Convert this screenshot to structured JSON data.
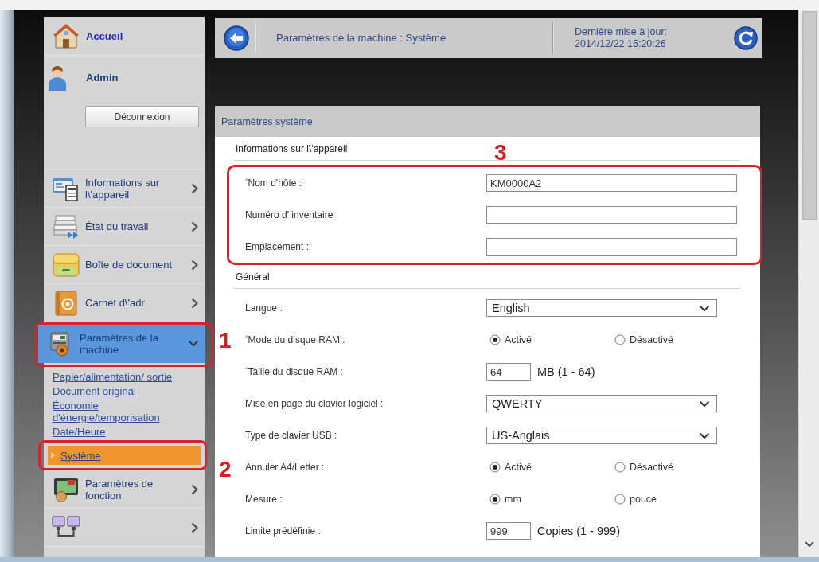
{
  "sidebar": {
    "home_link": "Accueil",
    "user": "Admin",
    "logout_button": "Déconnexion",
    "items": [
      {
        "kind": "info",
        "label": "Informations sur l\\'appareil",
        "selected": false,
        "expanded": false
      },
      {
        "kind": "job",
        "label": "État du travail",
        "selected": false,
        "expanded": false
      },
      {
        "kind": "box",
        "label": "Boîte de document",
        "selected": false,
        "expanded": false
      },
      {
        "kind": "addressbook",
        "label": "Carnet d\\'adr",
        "selected": false,
        "expanded": false
      },
      {
        "kind": "machine",
        "label": "Paramètres de la machine",
        "selected": true,
        "expanded": true,
        "callout": "1",
        "children": [
          {
            "label": "Papier/alimentation/ sortie",
            "selected": false
          },
          {
            "label": "Document original",
            "selected": false
          },
          {
            "label": "Économie d'énergie/temporisation",
            "selected": false
          },
          {
            "label": "Date/Heure",
            "selected": false
          },
          {
            "label": "Système",
            "selected": true,
            "callout": "2"
          }
        ]
      },
      {
        "kind": "function",
        "label": "Paramètres de fonction",
        "selected": false,
        "expanded": false
      },
      {
        "kind": "network",
        "selected": false,
        "expanded": false
      }
    ]
  },
  "header": {
    "title": "Paramètres de la machine : Système",
    "update_label": "Dernière mise à jour:",
    "update_time": "2014/12/22 15:20:26"
  },
  "panel": {
    "title": "Paramètres système",
    "sections": [
      {
        "heading": "Informations sur l\\'appareil",
        "callout": "3",
        "rows": [
          {
            "kind": "text",
            "label": "$^{*}$Nom d'hôte :",
            "value": "KM0000A2"
          },
          {
            "kind": "text",
            "label": "Numéro d' inventaire :"
          },
          {
            "kind": "text",
            "label": "Emplacement :"
          }
        ]
      },
      {
        "heading": "Général",
        "rows": [
          {
            "kind": "select",
            "label": "Langue :",
            "value": "English"
          },
          {
            "kind": "radio",
            "label": "$^{*}$Mode du disque RAM :",
            "options": [
              {
                "label": "Activé",
                "selected": true
              },
              {
                "label": "Désactivé",
                "selected": false
              }
            ]
          },
          {
            "kind": "number",
            "label": "$^{*}$Taille du disque RAM :",
            "value": "64",
            "unit": "MB (1 - 64)"
          },
          {
            "kind": "select",
            "label": "Mise en page du clavier logiciel :",
            "value": "QWERTY"
          },
          {
            "kind": "select",
            "label": "Type de clavier USB :",
            "value": "US-Anglais"
          },
          {
            "kind": "radio",
            "label": "Annuler A4/Letter :",
            "options": [
              {
                "label": "Activé",
                "selected": true
              },
              {
                "label": "Désactivé",
                "selected": false
              }
            ]
          },
          {
            "kind": "radio",
            "label": "Mesure :",
            "options": [
              {
                "label": "mm",
                "selected": true
              },
              {
                "label": "pouce",
                "selected": false
              }
            ]
          },
          {
            "kind": "number",
            "label": "Limite prédéfinie :",
            "value": "999",
            "unit": "Copies (1 - 999)"
          }
        ]
      }
    ]
  }
}
